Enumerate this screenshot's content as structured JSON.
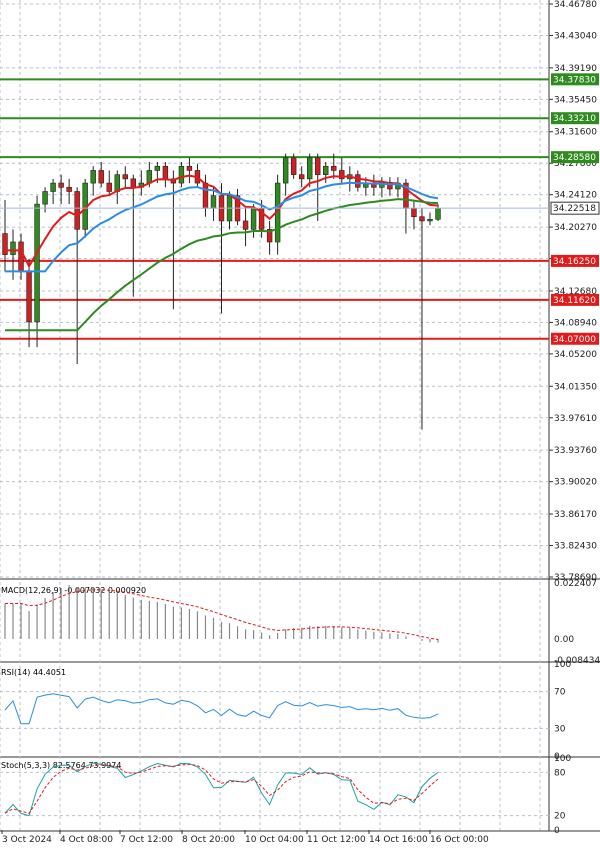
{
  "chart_data": {
    "type": "candlestick",
    "instrument_note": "",
    "price_axis": {
      "ticks": [
        "34.46780",
        "34.43040",
        "34.39190",
        "34.35450",
        "34.31600",
        "34.27860",
        "34.24120",
        "34.20270",
        "34.16530",
        "34.12680",
        "34.08940",
        "34.05200",
        "34.01350",
        "33.97610",
        "33.93760",
        "33.90020",
        "33.86170",
        "33.82430",
        "33.78690"
      ],
      "ylim": [
        33.7869,
        34.4678
      ]
    },
    "current_price": "34.22518",
    "horizontal_levels": [
      {
        "value": "34.37830",
        "color": "#2e8b1e"
      },
      {
        "value": "34.33210",
        "color": "#2e8b1e"
      },
      {
        "value": "34.28580",
        "color": "#2e8b1e"
      },
      {
        "value": "34.16250",
        "color": "#e31a1a"
      },
      {
        "value": "34.11620",
        "color": "#e31a1a"
      },
      {
        "value": "34.07000",
        "color": "#e31a1a"
      }
    ],
    "time_axis": [
      "3 Oct 2024",
      "4 Oct 08:00",
      "7 Oct 12:00",
      "8 Oct 20:00",
      "10 Oct 04:00",
      "11 Oct 12:00",
      "14 Oct 16:00",
      "16 Oct 00:00"
    ],
    "candles": [
      {
        "o": 34.195,
        "h": 34.235,
        "l": 34.15,
        "c": 34.17
      },
      {
        "o": 34.17,
        "h": 34.2,
        "l": 34.14,
        "c": 34.185
      },
      {
        "o": 34.185,
        "h": 34.195,
        "l": 34.14,
        "c": 34.15
      },
      {
        "o": 34.15,
        "h": 34.165,
        "l": 34.06,
        "c": 34.09
      },
      {
        "o": 34.09,
        "h": 34.24,
        "l": 34.06,
        "c": 34.23
      },
      {
        "o": 34.23,
        "h": 34.25,
        "l": 34.22,
        "c": 34.245
      },
      {
        "o": 34.245,
        "h": 34.26,
        "l": 34.23,
        "c": 34.255
      },
      {
        "o": 34.255,
        "h": 34.265,
        "l": 34.23,
        "c": 34.25
      },
      {
        "o": 34.25,
        "h": 34.26,
        "l": 34.23,
        "c": 34.245
      },
      {
        "o": 34.245,
        "h": 34.25,
        "l": 34.04,
        "c": 34.2
      },
      {
        "o": 34.2,
        "h": 34.26,
        "l": 34.19,
        "c": 34.255
      },
      {
        "o": 34.255,
        "h": 34.275,
        "l": 34.24,
        "c": 34.27
      },
      {
        "o": 34.27,
        "h": 34.28,
        "l": 34.25,
        "c": 34.255
      },
      {
        "o": 34.255,
        "h": 34.27,
        "l": 34.24,
        "c": 34.245
      },
      {
        "o": 34.245,
        "h": 34.27,
        "l": 34.23,
        "c": 34.265
      },
      {
        "o": 34.265,
        "h": 34.275,
        "l": 34.25,
        "c": 34.26
      },
      {
        "o": 34.26,
        "h": 34.265,
        "l": 34.12,
        "c": 34.25
      },
      {
        "o": 34.25,
        "h": 34.27,
        "l": 34.24,
        "c": 34.255
      },
      {
        "o": 34.255,
        "h": 34.28,
        "l": 34.25,
        "c": 34.27
      },
      {
        "o": 34.27,
        "h": 34.28,
        "l": 34.255,
        "c": 34.275
      },
      {
        "o": 34.275,
        "h": 34.28,
        "l": 34.25,
        "c": 34.26
      },
      {
        "o": 34.26,
        "h": 34.27,
        "l": 34.105,
        "c": 34.255
      },
      {
        "o": 34.255,
        "h": 34.28,
        "l": 34.25,
        "c": 34.275
      },
      {
        "o": 34.275,
        "h": 34.285,
        "l": 34.255,
        "c": 34.27
      },
      {
        "o": 34.27,
        "h": 34.278,
        "l": 34.25,
        "c": 34.255
      },
      {
        "o": 34.255,
        "h": 34.265,
        "l": 34.215,
        "c": 34.225
      },
      {
        "o": 34.225,
        "h": 34.25,
        "l": 34.21,
        "c": 34.24
      },
      {
        "o": 34.24,
        "h": 34.255,
        "l": 34.1,
        "c": 34.21
      },
      {
        "o": 34.21,
        "h": 34.245,
        "l": 34.2,
        "c": 34.24
      },
      {
        "o": 34.24,
        "h": 34.248,
        "l": 34.205,
        "c": 34.21
      },
      {
        "o": 34.21,
        "h": 34.225,
        "l": 34.18,
        "c": 34.2
      },
      {
        "o": 34.2,
        "h": 34.23,
        "l": 34.19,
        "c": 34.225
      },
      {
        "o": 34.225,
        "h": 34.235,
        "l": 34.19,
        "c": 34.2
      },
      {
        "o": 34.2,
        "h": 34.21,
        "l": 34.17,
        "c": 34.185
      },
      {
        "o": 34.185,
        "h": 34.265,
        "l": 34.17,
        "c": 34.255
      },
      {
        "o": 34.255,
        "h": 34.29,
        "l": 34.24,
        "c": 34.285
      },
      {
        "o": 34.285,
        "h": 34.29,
        "l": 34.26,
        "c": 34.265
      },
      {
        "o": 34.265,
        "h": 34.275,
        "l": 34.25,
        "c": 34.26
      },
      {
        "o": 34.26,
        "h": 34.29,
        "l": 34.25,
        "c": 34.285
      },
      {
        "o": 34.285,
        "h": 34.29,
        "l": 34.21,
        "c": 34.265
      },
      {
        "o": 34.265,
        "h": 34.28,
        "l": 34.255,
        "c": 34.275
      },
      {
        "o": 34.275,
        "h": 34.29,
        "l": 34.26,
        "c": 34.27
      },
      {
        "o": 34.27,
        "h": 34.285,
        "l": 34.255,
        "c": 34.26
      },
      {
        "o": 34.26,
        "h": 34.275,
        "l": 34.245,
        "c": 34.265
      },
      {
        "o": 34.265,
        "h": 34.27,
        "l": 34.245,
        "c": 34.25
      },
      {
        "o": 34.25,
        "h": 34.262,
        "l": 34.24,
        "c": 34.255
      },
      {
        "o": 34.255,
        "h": 34.265,
        "l": 34.24,
        "c": 34.25
      },
      {
        "o": 34.25,
        "h": 34.262,
        "l": 34.238,
        "c": 34.256
      },
      {
        "o": 34.256,
        "h": 34.262,
        "l": 34.24,
        "c": 34.248
      },
      {
        "o": 34.248,
        "h": 34.262,
        "l": 34.238,
        "c": 34.255
      },
      {
        "o": 34.255,
        "h": 34.26,
        "l": 34.195,
        "c": 34.225
      },
      {
        "o": 34.225,
        "h": 34.235,
        "l": 34.2,
        "c": 34.215
      },
      {
        "o": 34.215,
        "h": 34.225,
        "l": 33.962,
        "c": 34.21
      },
      {
        "o": 34.21,
        "h": 34.22,
        "l": 34.205,
        "c": 34.212
      },
      {
        "o": 34.212,
        "h": 34.23,
        "l": 34.21,
        "c": 34.225
      }
    ],
    "indicators": {
      "macd": {
        "label": "MACD(12,26,9) -0.007032 0.000920",
        "ticks": [
          "0.022407",
          "0.00",
          "-0.008434"
        ],
        "ylim": [
          -0.008434,
          0.022407
        ]
      },
      "rsi": {
        "label": "RSI(14) 44.4051",
        "ticks": [
          "100",
          "70",
          "30",
          "0"
        ],
        "ylim": [
          0,
          100
        ]
      },
      "stoch": {
        "label": "Stoch(5,3,3) 82.5764 73.9974",
        "ticks": [
          "100",
          "80",
          "20",
          "0"
        ],
        "ylim": [
          0,
          100
        ]
      }
    },
    "colors": {
      "bull": "#2e8b1e",
      "bear": "#d11f1f",
      "ma_fast": "#e31a1a",
      "ma_mid": "#2b8ce6",
      "ma_slow": "#2e8b1e"
    }
  }
}
